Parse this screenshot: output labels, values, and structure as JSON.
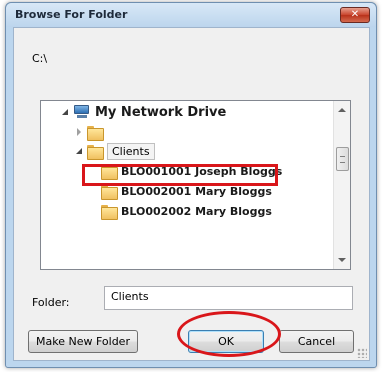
{
  "window": {
    "title": "Browse For Folder",
    "close_label": "✕"
  },
  "current_path": "C:\\",
  "tree": {
    "root": {
      "label": "My Network Drive",
      "icon": "network-drive-icon"
    },
    "collapsed_item": {
      "label": "",
      "icon": "folder-icon"
    },
    "clients": {
      "label": "Clients",
      "icon": "folder-icon"
    },
    "items": [
      {
        "label": "BLO001001 Joseph Bloggs",
        "icon": "folder-icon",
        "highlighted": true
      },
      {
        "label": "BLO002001 Mary Bloggs",
        "icon": "folder-icon",
        "highlighted": false
      },
      {
        "label": "BLO002002 Mary Bloggs",
        "icon": "folder-icon",
        "highlighted": false
      }
    ]
  },
  "folder_field": {
    "label": "Folder:",
    "value": "Clients"
  },
  "buttons": {
    "make_new_folder": "Make New Folder",
    "ok": "OK",
    "cancel": "Cancel"
  },
  "annotation_color": "#d9161a"
}
